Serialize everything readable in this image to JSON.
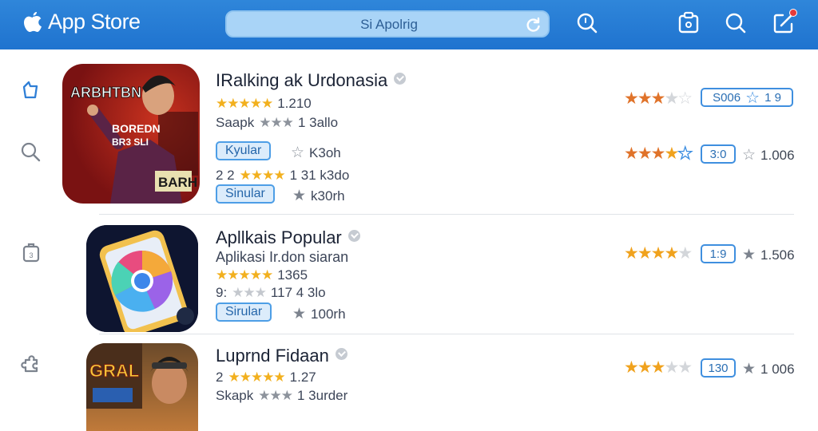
{
  "topbar": {
    "app_name": "App Store",
    "search_text": "Si Apolrig",
    "icons": [
      "apple-logo-icon",
      "refresh-icon",
      "search-icon",
      "clipboard-icon",
      "search-icon",
      "edit-icon"
    ]
  },
  "rail": {
    "icons": [
      "star-outline-icon",
      "search-icon",
      "clipboard-icon",
      "puzzle-icon"
    ]
  },
  "apps": [
    {
      "title": "IRalking ak Urdonasia",
      "line1": {
        "stars": 4.5,
        "value": "1.210"
      },
      "line2": {
        "prefix": "Saapk",
        "stars": 2,
        "value": "1 3allo"
      },
      "pill1": "Kyular",
      "pill1_after": "K3oh",
      "line3": {
        "prefix": "2 2",
        "stars": 4.5,
        "value": "1 31 k3do"
      },
      "pill2": "Sinular",
      "pill2_after": "k30rh",
      "art_text_top": "ARBHTBN",
      "art_text_mid": "BOREDN",
      "art_text_mid2": "BR3 SLI",
      "art_text_bottom": "BARH",
      "right": [
        {
          "stars": 3,
          "box_text": "S006",
          "box2": "1 9"
        },
        {
          "stars": 3.5,
          "box_text": "3:0",
          "value": "1.006"
        }
      ]
    },
    {
      "title": "Apllkais Popular",
      "line1": {
        "text": "Aplikasi Ir.don siaran"
      },
      "line2": {
        "stars": 4.5,
        "value": "1365"
      },
      "line3": {
        "prefix": "9:",
        "stars": 2,
        "value": "117 4 3lo"
      },
      "pill": "Sirular",
      "pill_after": "100rh",
      "right": {
        "stars": 4,
        "box_text": "1:9",
        "value": "1.506"
      }
    },
    {
      "title": "Luprnd Fidaan",
      "line1": {
        "prefix": "2",
        "stars": 4.5,
        "value": "1.27"
      },
      "line2": {
        "prefix": "Skapk",
        "stars": 2,
        "value": "1 3urder"
      },
      "art_text": "GRAL",
      "right": {
        "stars": 3,
        "box_text": "130",
        "value": "1 006"
      }
    }
  ],
  "colors": {
    "topbar": "#1f73cf",
    "accent": "#4d9ee6",
    "star": "#f2b01e",
    "star_orange": "#e0732a"
  }
}
